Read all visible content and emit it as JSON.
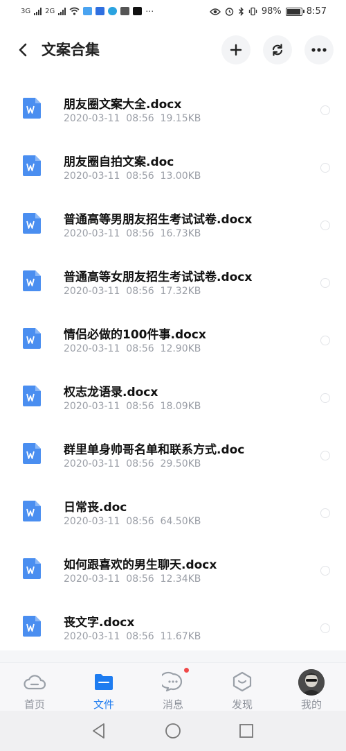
{
  "status_bar": {
    "net1": "3G",
    "net2": "2G",
    "battery": "98%",
    "time": "8:57",
    "battery_level": 0.98
  },
  "header": {
    "title": "文案合集",
    "back_icon": "chevron-left-icon",
    "add_icon": "plus-icon",
    "refresh_icon": "sync-icon",
    "more_icon": "more-horizontal-icon"
  },
  "files": [
    {
      "name": "朋友圈文案大全.docx",
      "date": "2020-03-11",
      "time": "08:56",
      "size": "19.15KB"
    },
    {
      "name": "朋友圈自拍文案.doc",
      "date": "2020-03-11",
      "time": "08:56",
      "size": "13.00KB"
    },
    {
      "name": "普通高等男朋友招生考试试卷.docx",
      "date": "2020-03-11",
      "time": "08:56",
      "size": "16.73KB"
    },
    {
      "name": "普通高等女朋友招生考试试卷.docx",
      "date": "2020-03-11",
      "time": "08:56",
      "size": "17.32KB"
    },
    {
      "name": "情侣必做的100件事.docx",
      "date": "2020-03-11",
      "time": "08:56",
      "size": "12.90KB"
    },
    {
      "name": "权志龙语录.docx",
      "date": "2020-03-11",
      "time": "08:56",
      "size": "18.09KB"
    },
    {
      "name": "群里单身帅哥名单和联系方式.doc",
      "date": "2020-03-11",
      "time": "08:56",
      "size": "29.50KB"
    },
    {
      "name": "日常丧.doc",
      "date": "2020-03-11",
      "time": "08:56",
      "size": "64.50KB"
    },
    {
      "name": "如何跟喜欢的男生聊天.docx",
      "date": "2020-03-11",
      "time": "08:56",
      "size": "12.34KB"
    },
    {
      "name": "丧文字.docx",
      "date": "2020-03-11",
      "time": "08:56",
      "size": "11.67KB"
    }
  ],
  "tabs": [
    {
      "label": "首页",
      "icon": "cloud-icon"
    },
    {
      "label": "文件",
      "icon": "folder-icon"
    },
    {
      "label": "消息",
      "icon": "chat-icon"
    },
    {
      "label": "发现",
      "icon": "discover-icon"
    },
    {
      "label": "我的",
      "icon": "avatar"
    }
  ],
  "colors": {
    "accent": "#1e7cf0",
    "doc_icon": "#4a8ef0",
    "badge": "#f04848",
    "meta_text": "#9a9ea6"
  }
}
